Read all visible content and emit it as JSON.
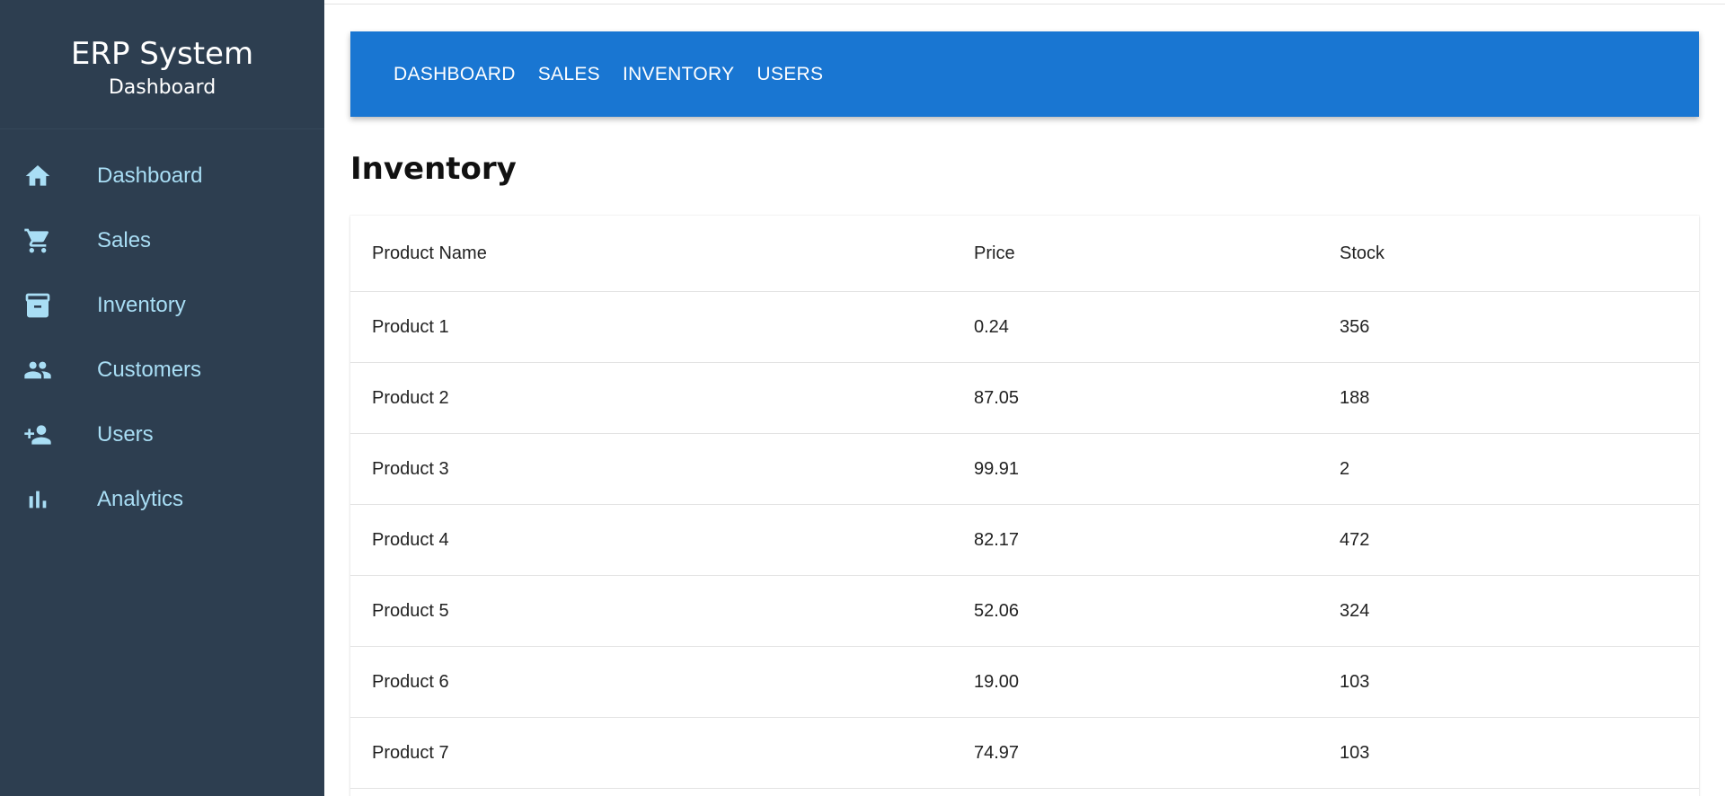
{
  "sidebar": {
    "title": "ERP System",
    "subtitle": "Dashboard",
    "items": [
      {
        "label": "Dashboard",
        "icon": "home-icon"
      },
      {
        "label": "Sales",
        "icon": "shopping-cart-icon"
      },
      {
        "label": "Inventory",
        "icon": "archive-icon"
      },
      {
        "label": "Customers",
        "icon": "people-icon"
      },
      {
        "label": "Users",
        "icon": "person-add-icon"
      },
      {
        "label": "Analytics",
        "icon": "bar-chart-icon"
      }
    ]
  },
  "appbar": {
    "links": [
      "DASHBOARD",
      "SALES",
      "INVENTORY",
      "USERS"
    ]
  },
  "main": {
    "page_title": "Inventory",
    "table": {
      "headers": [
        "Product Name",
        "Price",
        "Stock"
      ],
      "rows": [
        [
          "Product 1",
          "0.24",
          "356"
        ],
        [
          "Product 2",
          "87.05",
          "188"
        ],
        [
          "Product 3",
          "99.91",
          "2"
        ],
        [
          "Product 4",
          "82.17",
          "472"
        ],
        [
          "Product 5",
          "52.06",
          "324"
        ],
        [
          "Product 6",
          "19.00",
          "103"
        ],
        [
          "Product 7",
          "74.97",
          "103"
        ]
      ]
    }
  },
  "colors": {
    "sidebar_bg": "#2d3e50",
    "sidebar_text": "#a9def5",
    "appbar_bg": "#1976d2"
  }
}
